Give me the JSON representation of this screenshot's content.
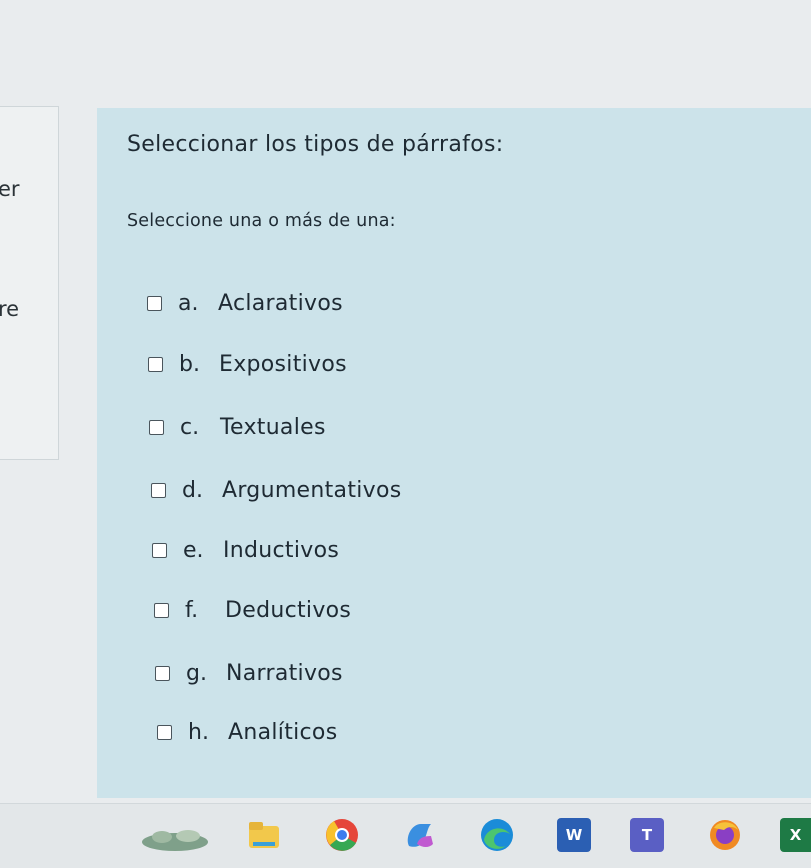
{
  "left_panel": {
    "fragment_1": "er",
    "fragment_2": "re"
  },
  "question": {
    "title": "Seleccionar los tipos de párrafos:",
    "instruction": "Seleccione una o más de una:",
    "options": [
      {
        "letter": "a.",
        "text": "Aclarativos",
        "checked": false
      },
      {
        "letter": "b.",
        "text": "Expositivos",
        "checked": false
      },
      {
        "letter": "c.",
        "text": "Textuales",
        "checked": false
      },
      {
        "letter": "d.",
        "text": "Argumentativos",
        "checked": false
      },
      {
        "letter": "e.",
        "text": "Inductivos",
        "checked": false
      },
      {
        "letter": "f.",
        "text": "Deductivos",
        "checked": false
      },
      {
        "letter": "g.",
        "text": "Narrativos",
        "checked": false
      },
      {
        "letter": "h.",
        "text": "Analíticos",
        "checked": false
      }
    ]
  },
  "taskbar": {
    "apps": [
      {
        "name": "weather-widget-icon",
        "label": ""
      },
      {
        "name": "file-explorer-icon",
        "label": ""
      },
      {
        "name": "chrome-icon",
        "label": ""
      },
      {
        "name": "copilot-icon",
        "label": ""
      },
      {
        "name": "edge-icon",
        "label": ""
      },
      {
        "name": "word-icon",
        "label": "W"
      },
      {
        "name": "teams-icon",
        "label": "T"
      },
      {
        "name": "firefox-icon",
        "label": ""
      },
      {
        "name": "excel-icon",
        "label": "X"
      }
    ]
  },
  "colors": {
    "page_background": "#e9ecee",
    "question_background": "#cce3ea",
    "text": "#1e2a33",
    "checkbox_border": "#4a555c"
  }
}
